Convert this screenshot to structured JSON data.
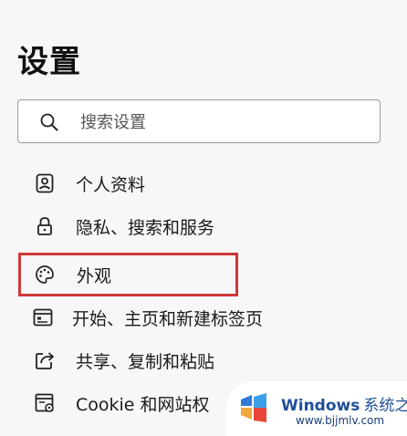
{
  "header": {
    "title": "设置"
  },
  "search": {
    "placeholder": "搜索设置"
  },
  "nav": {
    "items": [
      {
        "label": "个人资料",
        "icon": "profile-icon"
      },
      {
        "label": "隐私、搜索和服务",
        "icon": "lock-icon"
      },
      {
        "label": "外观",
        "icon": "palette-icon",
        "selected": true
      },
      {
        "label": "开始、主页和新建标签页",
        "icon": "start-page-icon"
      },
      {
        "label": "共享、复制和粘贴",
        "icon": "share-icon"
      },
      {
        "label": "Cookie 和网站权",
        "icon": "cookie-icon"
      }
    ]
  },
  "watermark": {
    "brand": "Windows",
    "cn": "系统之家",
    "url": "www.bjjmlv.com"
  },
  "colors": {
    "highlight": "#d0373a",
    "background": "#f7f7f7"
  }
}
